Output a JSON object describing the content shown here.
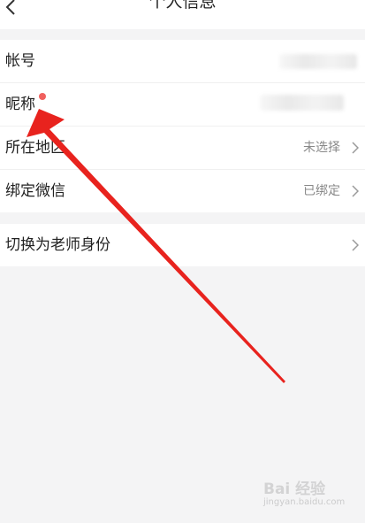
{
  "header": {
    "title": "个人信息",
    "back_icon": "chevron-left-icon"
  },
  "profile_rows": [
    {
      "label": "帐号",
      "value": ""
    },
    {
      "label": "昵称",
      "value": ""
    },
    {
      "label": "所在地区",
      "value": "未选择"
    },
    {
      "label": "绑定微信",
      "value": "已绑定"
    }
  ],
  "switch_row": {
    "label": "切换为老师身份"
  },
  "annotation": {
    "arrow_color": "#e8231e"
  },
  "watermark": {
    "logo": "Bai 经验",
    "sub": "jingyan.baidu.com"
  },
  "colors": {
    "background": "#f4f4f5",
    "row_background": "#ffffff",
    "secondary_text": "#888888",
    "notice_dot": "#f0605e"
  }
}
